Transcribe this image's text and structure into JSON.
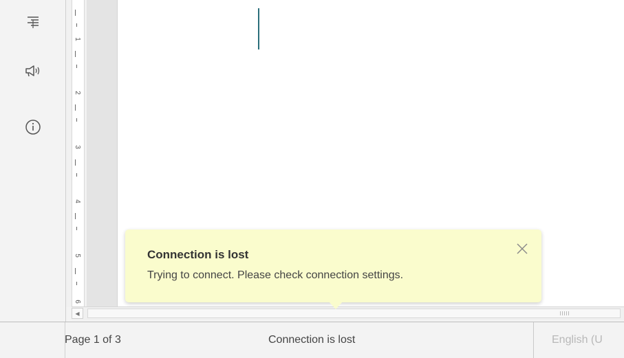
{
  "sidebar": {
    "items": [
      {
        "icon": "align-text-icon"
      },
      {
        "icon": "megaphone-icon"
      },
      {
        "icon": "info-icon"
      }
    ]
  },
  "ruler": {
    "numbers": [
      "1",
      "2",
      "3",
      "4",
      "5",
      "6"
    ]
  },
  "notification": {
    "title": "Connection is lost",
    "message": "Trying to connect. Please check connection settings.",
    "close_icon": "close-icon",
    "background_color": "#fafccd"
  },
  "status_bar": {
    "page_info": "Page 1 of 3",
    "status_message": "Connection is lost",
    "language": "English (U"
  },
  "colors": {
    "caret": "#2a6e7a"
  }
}
